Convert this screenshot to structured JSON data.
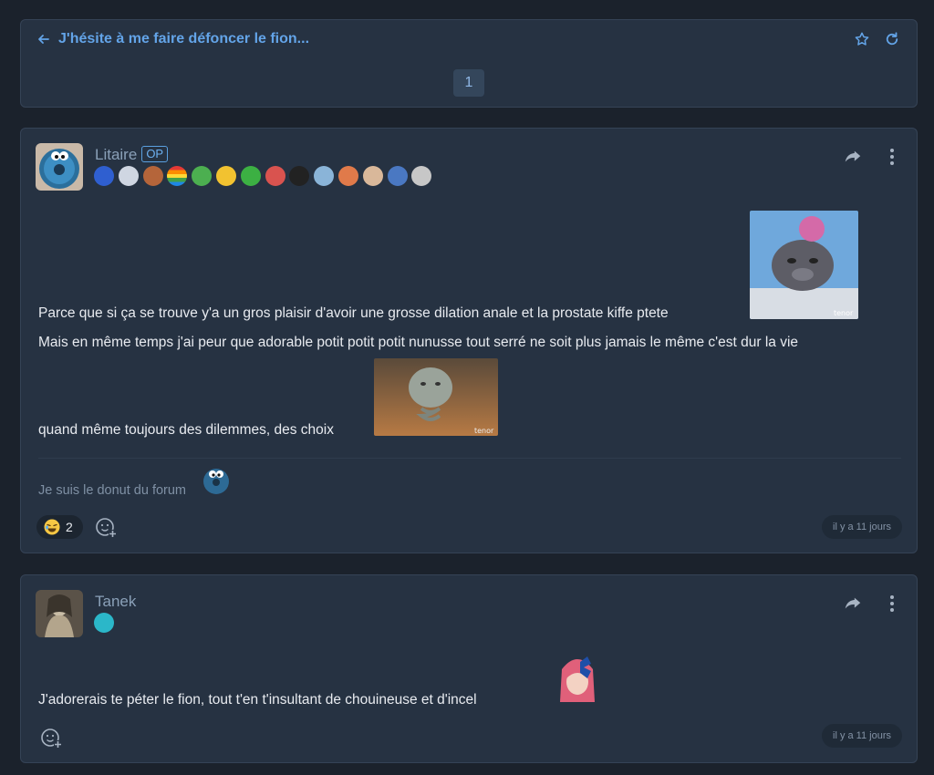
{
  "topic": {
    "title": "J'hésite à me faire défoncer le fion...",
    "current_page": "1",
    "back_icon": "arrow-left-icon",
    "favorite_icon": "star-icon",
    "refresh_icon": "refresh-icon"
  },
  "posts": [
    {
      "author": "Litaire",
      "op_label": "OP",
      "lines": [
        "Parce que si ça se trouve y'a un gros plaisir d'avoir une grosse dilation anale et la prostate kiffe ptete",
        "Mais en même temps j'ai peur que adorable potit potit potit nunusse tout serré ne soit plus jamais le même c'est dur la vie",
        "quand même toujours des dilemmes, des choix"
      ],
      "gif_watermark": "tenor",
      "signature": "Je suis le donut du forum",
      "reaction_count": "2",
      "time": "il y a 11 jours"
    },
    {
      "author": "Tanek",
      "lines": [
        "J'adorerais te péter le fion, tout t'en t'insultant de chouineuse et d'incel"
      ],
      "time": "il y a 11 jours"
    }
  ],
  "colors": {
    "background": "#1b222c",
    "card": "#263242",
    "accent": "#63a4e8",
    "muted": "#8493a6"
  }
}
